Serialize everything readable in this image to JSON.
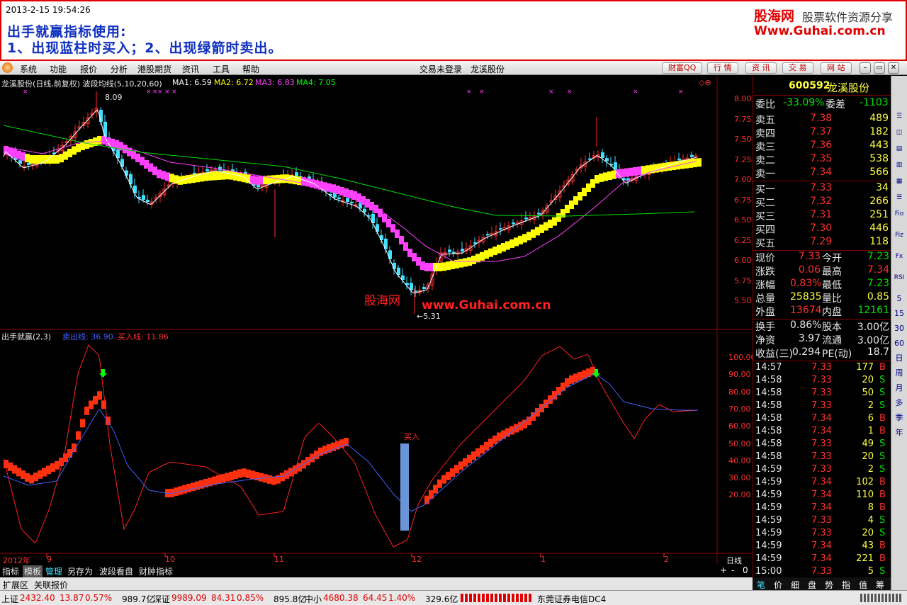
{
  "banner": {
    "timestamp": "2013-2-15 19:54:26",
    "title": "出手就赢指标使用:",
    "instruction": "1、出现蓝柱时买入；2、出现绿箭时卖出。",
    "logo": "股海网",
    "slogan": "股票软件资源分享",
    "url": "Www.Guhai.com.cn"
  },
  "menu": {
    "items": [
      "系统",
      "功能",
      "报价",
      "分析",
      "港股期货",
      "资讯",
      "工具",
      "帮助"
    ],
    "status": "交易未登录",
    "stock_name": "龙溪股份",
    "buttons": [
      "财富QQ",
      "行 情",
      "资 讯",
      "交 易",
      "网 站"
    ]
  },
  "main_chart": {
    "info_prefix": "龙溪股份(日线,前复权) 波段均线(5,10,20,60)",
    "ma": [
      {
        "label": "MA1: 6.59",
        "color": "#ffffff"
      },
      {
        "label": "MA2: 6.72",
        "color": "#ffff00"
      },
      {
        "label": "MA3: 6.83",
        "color": "#ff40ff"
      },
      {
        "label": "MA4: 7.05",
        "color": "#00ff00"
      }
    ],
    "high_label": "8.09",
    "low_label": "←5.31",
    "watermark_cn": "股海网",
    "watermark_url": "www.Guhai.com.cn",
    "y_axis": [
      "8.00",
      "7.75",
      "7.50",
      "7.25",
      "7.00",
      "6.75",
      "6.50",
      "6.25",
      "6.00",
      "5.75",
      "5.50"
    ]
  },
  "indicator": {
    "name": "出手就赢(2,3)",
    "sell_label": "卖出线: 36.90",
    "buy_label": "买入线: 11.86",
    "buy_marker": "买入",
    "y_axis": [
      "100.00",
      "90.00",
      "80.00",
      "70.00",
      "60.00",
      "50.00",
      "40.00",
      "30.00",
      "20.00"
    ]
  },
  "x_axis": {
    "labels": [
      "2012年",
      "9",
      "10",
      "11",
      "12",
      "1",
      "2"
    ],
    "period": "日线"
  },
  "bottom_tabs": [
    "指标",
    "模板",
    "管理",
    "另存为",
    "波段看盘",
    "财肿指标"
  ],
  "ext_tabs": [
    "扩展区",
    "关联报价"
  ],
  "quote": {
    "code": "600592",
    "name": "龙溪股份",
    "weibi_label": "委比",
    "weibi": "-33.09%",
    "weicha_label": "委差",
    "weicha": "-1103",
    "asks": [
      {
        "label": "卖五",
        "price": "7.38",
        "vol": "489"
      },
      {
        "label": "卖四",
        "price": "7.37",
        "vol": "182"
      },
      {
        "label": "卖三",
        "price": "7.36",
        "vol": "443"
      },
      {
        "label": "卖二",
        "price": "7.35",
        "vol": "538"
      },
      {
        "label": "卖一",
        "price": "7.34",
        "vol": "566"
      }
    ],
    "bids": [
      {
        "label": "买一",
        "price": "7.33",
        "vol": "34"
      },
      {
        "label": "买二",
        "price": "7.32",
        "vol": "266"
      },
      {
        "label": "买三",
        "price": "7.31",
        "vol": "251"
      },
      {
        "label": "买四",
        "price": "7.30",
        "vol": "446"
      },
      {
        "label": "买五",
        "price": "7.29",
        "vol": "118"
      }
    ],
    "stats": [
      {
        "l1": "现价",
        "v1": "7.33",
        "c1": "red",
        "l2": "今开",
        "v2": "7.23",
        "c2": "green"
      },
      {
        "l1": "涨跌",
        "v1": "0.06",
        "c1": "red",
        "l2": "最高",
        "v2": "7.34",
        "c2": "red"
      },
      {
        "l1": "涨幅",
        "v1": "0.83%",
        "c1": "red",
        "l2": "最低",
        "v2": "7.23",
        "c2": "green"
      },
      {
        "l1": "总量",
        "v1": "25835",
        "c1": "yellow",
        "l2": "量比",
        "v2": "0.85",
        "c2": "yellow"
      },
      {
        "l1": "外盘",
        "v1": "13674",
        "c1": "red",
        "l2": "内盘",
        "v2": "12161",
        "c2": "green"
      }
    ],
    "stats2": [
      {
        "l1": "换手",
        "v1": "0.86%",
        "l2": "股本",
        "v2": "3.00亿"
      },
      {
        "l1": "净资",
        "v1": "3.97",
        "l2": "流通",
        "v2": "3.00亿"
      },
      {
        "l1": "收益(三)",
        "v1": "0.294",
        "l2": "PE(动)",
        "v2": "18.7"
      }
    ],
    "ticks": [
      [
        "14:57",
        "7.33",
        "177",
        "B"
      ],
      [
        "14:58",
        "7.33",
        "20",
        "S"
      ],
      [
        "14:58",
        "7.33",
        "50",
        "S"
      ],
      [
        "14:58",
        "7.33",
        "2",
        "S"
      ],
      [
        "14:58",
        "7.34",
        "6",
        "B"
      ],
      [
        "14:58",
        "7.34",
        "1",
        "B"
      ],
      [
        "14:58",
        "7.33",
        "49",
        "S"
      ],
      [
        "14:58",
        "7.33",
        "20",
        "S"
      ],
      [
        "14:59",
        "7.33",
        "2",
        "S"
      ],
      [
        "14:59",
        "7.34",
        "102",
        "B"
      ],
      [
        "14:59",
        "7.34",
        "110",
        "B"
      ],
      [
        "14:59",
        "7.34",
        "8",
        "B"
      ],
      [
        "14:59",
        "7.33",
        "4",
        "S"
      ],
      [
        "14:59",
        "7.33",
        "20",
        "S"
      ],
      [
        "14:59",
        "7.34",
        "43",
        "B"
      ],
      [
        "14:59",
        "7.34",
        "221",
        "B"
      ],
      [
        "15:00",
        "7.33",
        "5",
        "S"
      ]
    ]
  },
  "right_tabs": [
    "笔",
    "价",
    "细",
    "盘",
    "势",
    "指",
    "值",
    "筹"
  ],
  "right_tools": [
    "Fio",
    "Fiz",
    "Fx",
    "RSI",
    "5",
    "15",
    "30",
    "60",
    "日",
    "周",
    "月",
    "多",
    "季",
    "年"
  ],
  "status_bar": [
    {
      "label": "上证",
      "value": "2432.40",
      "chg": "13.87",
      "pct": "0.57%",
      "amt": "989.7亿"
    },
    {
      "label": "深证",
      "value": "9989.09",
      "chg": "84.31",
      "pct": "0.85%",
      "amt": "895.8亿"
    },
    {
      "label": "中小",
      "value": "4680.38",
      "chg": "64.45",
      "pct": "1.40%",
      "amt": "329.6亿"
    }
  ],
  "broker": "东莞证券电信DC4"
}
